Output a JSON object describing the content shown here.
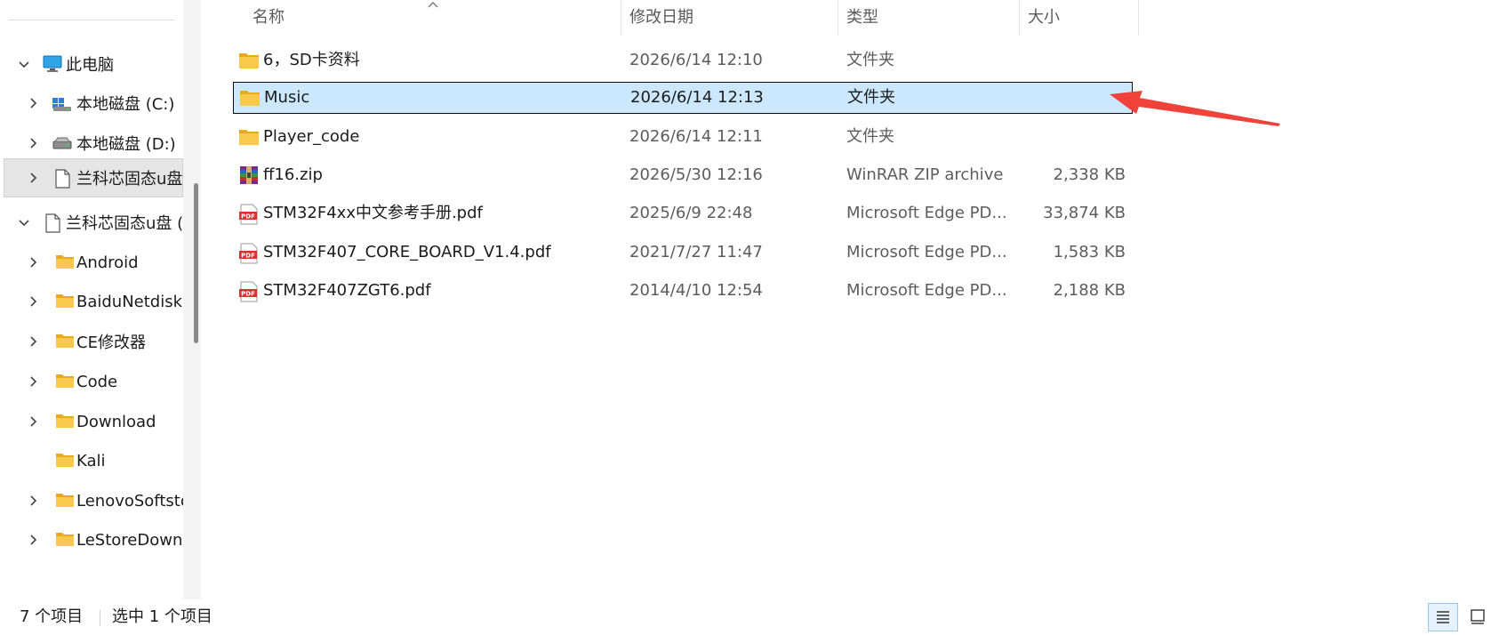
{
  "sidebar": {
    "items": [
      {
        "label": "此电脑",
        "icon": "monitor-icon",
        "chevron": "expanded"
      },
      {
        "label": "本地磁盘 (C:)",
        "icon": "windows-drive-icon",
        "chevron": "collapsed"
      },
      {
        "label": "本地磁盘 (D:)",
        "icon": "drive-icon",
        "chevron": "collapsed"
      },
      {
        "label": "兰科芯固态u盘",
        "icon": "document-icon",
        "chevron": "collapsed",
        "selected": true
      },
      {
        "label": "兰科芯固态u盘 (",
        "icon": "document-icon",
        "chevron": "expanded"
      },
      {
        "label": "Android",
        "icon": "folder-icon",
        "chevron": "collapsed"
      },
      {
        "label": "BaiduNetdisk",
        "icon": "folder-icon",
        "chevron": "collapsed"
      },
      {
        "label": "CE修改器",
        "icon": "folder-icon",
        "chevron": "collapsed"
      },
      {
        "label": "Code",
        "icon": "folder-icon",
        "chevron": "collapsed"
      },
      {
        "label": "Download",
        "icon": "folder-icon",
        "chevron": "collapsed"
      },
      {
        "label": "Kali",
        "icon": "folder-icon",
        "chevron": "none"
      },
      {
        "label": "LenovoSoftsto",
        "icon": "folder-icon",
        "chevron": "collapsed"
      },
      {
        "label": "LeStoreDown",
        "icon": "folder-icon",
        "chevron": "collapsed"
      }
    ]
  },
  "columns": {
    "name": "名称",
    "date": "修改日期",
    "type": "类型",
    "size": "大小"
  },
  "files": [
    {
      "name": "6，SD卡资料",
      "date": "2026/6/14 12:10",
      "type": "文件夹",
      "size": "",
      "icon": "folder-icon"
    },
    {
      "name": "Music",
      "date": "2026/6/14 12:13",
      "type": "文件夹",
      "size": "",
      "icon": "folder-icon",
      "selected": true
    },
    {
      "name": "Player_code",
      "date": "2026/6/14 12:11",
      "type": "文件夹",
      "size": "",
      "icon": "folder-icon"
    },
    {
      "name": "ff16.zip",
      "date": "2026/5/30 12:16",
      "type": "WinRAR ZIP archive",
      "size": "2,338 KB",
      "icon": "winrar-icon"
    },
    {
      "name": "STM32F4xx中文参考手册.pdf",
      "date": "2025/6/9 22:48",
      "type": "Microsoft Edge PD...",
      "size": "33,874 KB",
      "icon": "pdf-icon"
    },
    {
      "name": "STM32F407_CORE_BOARD_V1.4.pdf",
      "date": "2021/7/27 11:47",
      "type": "Microsoft Edge PD...",
      "size": "1,583 KB",
      "icon": "pdf-icon"
    },
    {
      "name": "STM32F407ZGT6.pdf",
      "date": "2014/4/10 12:54",
      "type": "Microsoft Edge PD...",
      "size": "2,188 KB",
      "icon": "pdf-icon"
    }
  ],
  "status": {
    "item_count": "7 个项目",
    "selection": "选中 1 个项目"
  },
  "colors": {
    "selection_bg": "#cce8ff",
    "folder": "#f8c94b",
    "pdf": "#d7322b",
    "annotation_arrow": "#f0413b"
  }
}
